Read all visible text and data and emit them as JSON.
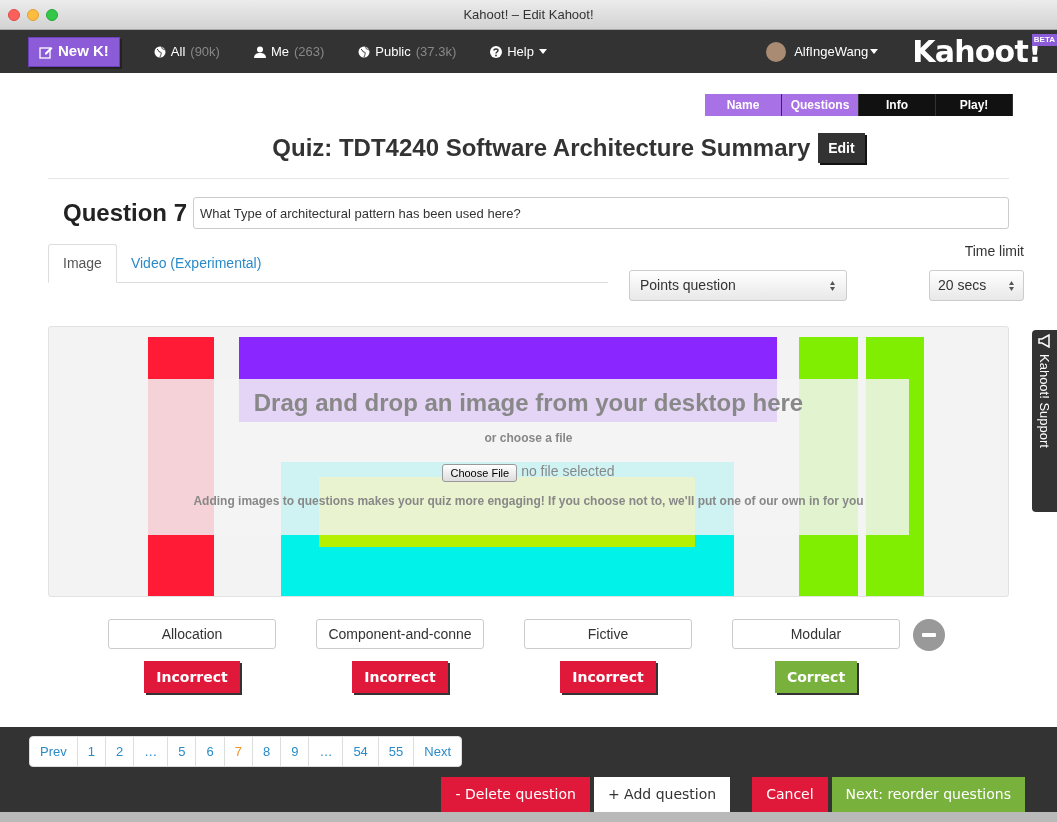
{
  "window": {
    "title": "Kahoot! – Edit Kahoot!"
  },
  "navbar": {
    "new_button": "New K!",
    "links": [
      {
        "kind": "globe",
        "label": "All",
        "count": "(90k)",
        "dropdown": false
      },
      {
        "kind": "person",
        "label": "Me",
        "count": "(263)",
        "dropdown": false
      },
      {
        "kind": "globe",
        "label": "Public",
        "count": "(37.3k)",
        "dropdown": false
      },
      {
        "kind": "help",
        "label": "Help",
        "dropdown": true
      }
    ],
    "user": "AlfIngeWang",
    "logo": "Kahoot!",
    "badge": "BETA"
  },
  "steps": [
    {
      "label": "Name",
      "completed": true
    },
    {
      "label": "Questions",
      "completed": true
    },
    {
      "label": "Info",
      "completed": false
    },
    {
      "label": "Play!",
      "completed": false
    }
  ],
  "quiz": {
    "title": "Quiz: TDT4240 Software Architecture Summary",
    "edit_button": "Edit"
  },
  "question": {
    "label": "Question 7",
    "value": "What Type of architectural pattern has been used here?"
  },
  "media_tabs": [
    {
      "label": "Image",
      "selected": true
    },
    {
      "label": "Video (Experimental)",
      "selected": false
    }
  ],
  "question_type": {
    "value": "Points question"
  },
  "time_limit": {
    "label": "Time limit",
    "value": "20 secs"
  },
  "dropzone": {
    "heading": "Drag and drop an image from your desktop here",
    "subheading": "or choose a file",
    "file_button": "Choose File",
    "file_status": "no file selected",
    "hint": "Adding images to questions makes your quiz more engaging! If you choose not to, we'll put one of our own in for you"
  },
  "answers": [
    {
      "value": "Allocation",
      "correct": false,
      "status": "Incorrect"
    },
    {
      "value": "Component-and-conne",
      "correct": false,
      "status": "Incorrect"
    },
    {
      "value": "Fictive",
      "correct": false,
      "status": "Incorrect"
    },
    {
      "value": "Modular",
      "correct": true,
      "status": "Correct"
    }
  ],
  "pagination": [
    {
      "label": "Prev",
      "selected": false
    },
    {
      "label": "1",
      "selected": false
    },
    {
      "label": "2",
      "selected": false
    },
    {
      "label": "…",
      "selected": false
    },
    {
      "label": "5",
      "selected": false
    },
    {
      "label": "6",
      "selected": false
    },
    {
      "label": "7",
      "selected": true
    },
    {
      "label": "8",
      "selected": false
    },
    {
      "label": "9",
      "selected": false
    },
    {
      "label": "…",
      "selected": false
    },
    {
      "label": "54",
      "selected": false
    },
    {
      "label": "55",
      "selected": false
    },
    {
      "label": "Next",
      "selected": false
    }
  ],
  "actions": [
    {
      "label": "- Delete question",
      "kind": "danger"
    },
    {
      "label": "+ Add question",
      "kind": "default"
    },
    {
      "label": "Cancel",
      "kind": "danger"
    },
    {
      "label": "Next: reorder questions",
      "kind": "success"
    }
  ],
  "support_tab": "Kahoot! Support"
}
